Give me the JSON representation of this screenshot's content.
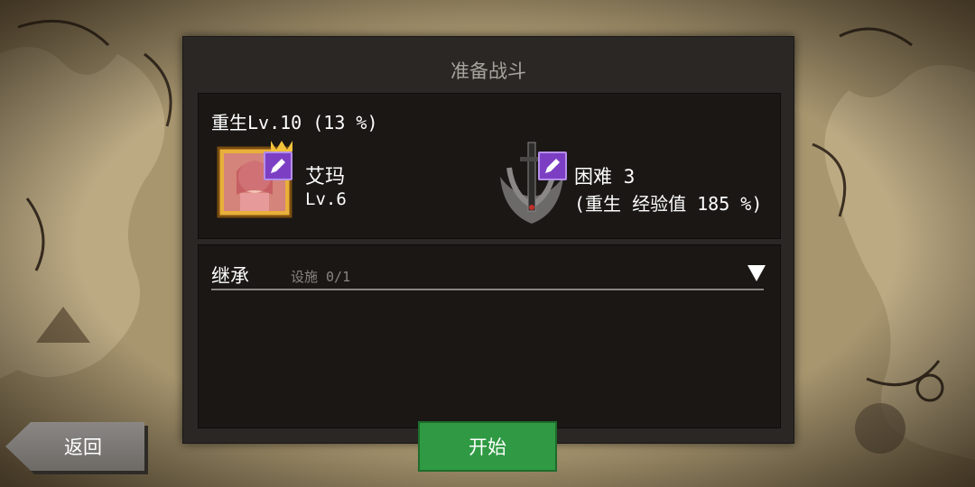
{
  "panel": {
    "title": "准备战斗"
  },
  "rebirth": {
    "text": "重生Lv.10 (13 %)"
  },
  "hero": {
    "name": "艾玛",
    "level": "Lv.6"
  },
  "difficulty": {
    "name": "困难 3",
    "bonus": "(重生 经验值 185 %)"
  },
  "inherit": {
    "label": "继承",
    "sub": "设施 0/1"
  },
  "buttons": {
    "back": "返回",
    "start": "开始"
  },
  "icons": {
    "edit": "pencil-icon",
    "dropdown": "triangle-down-icon",
    "expand": "chevron-down-icon"
  },
  "colors": {
    "accent_purple": "#7c3fc4",
    "start_green": "#2f9a43",
    "panel_dark": "#2a2725"
  }
}
